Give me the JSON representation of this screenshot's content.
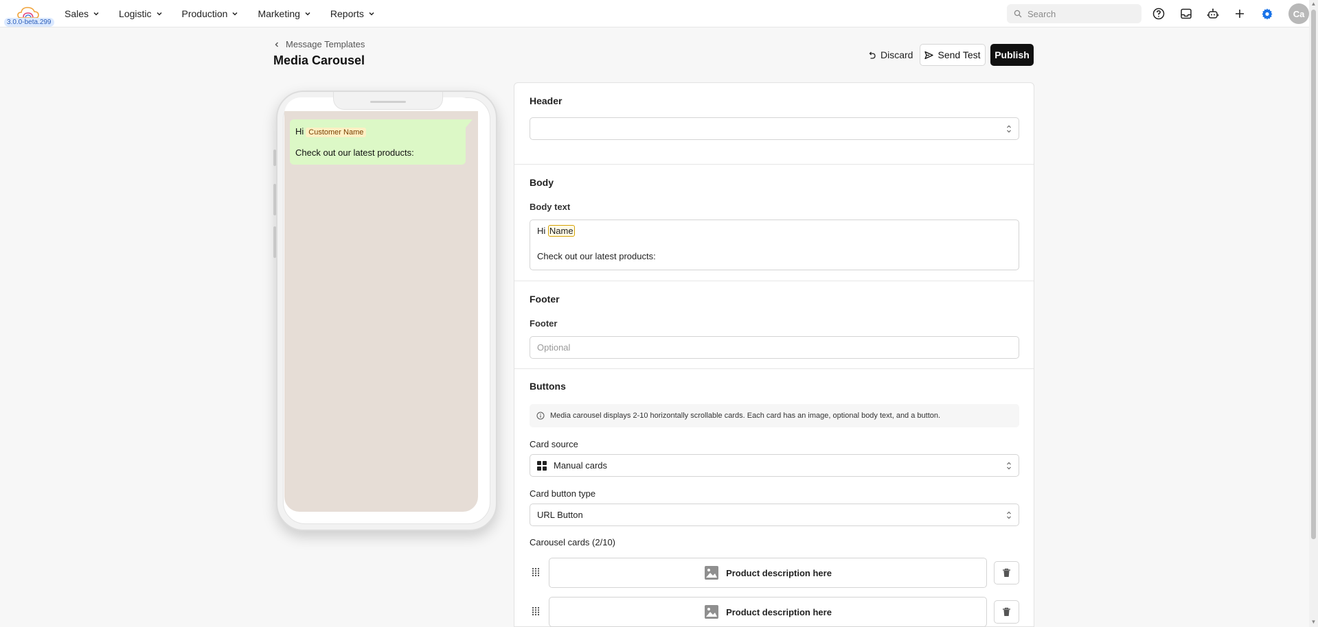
{
  "app": {
    "version": "3.0.0-beta.299"
  },
  "nav": {
    "items": [
      {
        "label": "Sales"
      },
      {
        "label": "Logistic"
      },
      {
        "label": "Production"
      },
      {
        "label": "Marketing"
      },
      {
        "label": "Reports"
      }
    ],
    "search_placeholder": "Search",
    "avatar_initials": "Ca"
  },
  "page": {
    "breadcrumb": "Message Templates",
    "title": "Media Carousel",
    "discard_label": "Discard",
    "send_test_label": "Send Test",
    "publish_label": "Publish"
  },
  "preview": {
    "greeting": "Hi",
    "variable": "Customer Name",
    "line2": "Check out our latest products:"
  },
  "form": {
    "header": {
      "title": "Header",
      "value": ""
    },
    "body": {
      "title": "Body",
      "label": "Body text",
      "greeting": "Hi",
      "variable": "Name",
      "line2": "Check out our latest products:"
    },
    "footer": {
      "title": "Footer",
      "label": "Footer",
      "placeholder": "Optional"
    },
    "buttons": {
      "title": "Buttons",
      "info": "Media carousel displays 2-10 horizontally scrollable cards. Each card has an image, optional body text, and a button.",
      "card_source_label": "Card source",
      "card_source_value": "Manual cards",
      "card_button_type_label": "Card button type",
      "card_button_type_value": "URL Button",
      "carousel_cards_label": "Carousel cards (2/10)",
      "cards": [
        {
          "description": "Product description here"
        },
        {
          "description": "Product description here"
        }
      ]
    }
  },
  "colors": {
    "bubble": "#dcf8c6",
    "chat_bg": "#e6ddd6",
    "publish_bg": "#111111",
    "settings_icon": "#1a73e8"
  }
}
